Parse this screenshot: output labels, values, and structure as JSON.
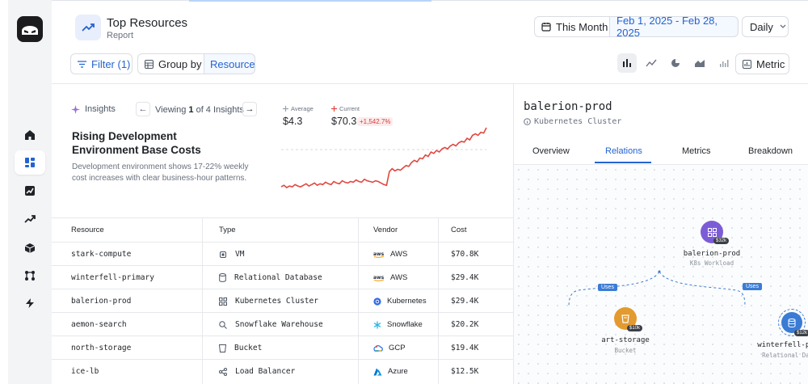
{
  "header": {
    "title": "Top Resources",
    "subtitle": "Report",
    "period_label": "This Month",
    "date_range": "Feb 1, 2025 - Feb 28, 2025",
    "granularity": "Daily",
    "filter_label": "Filter (1)",
    "group_by_label": "Group by",
    "group_by_value": "Resource",
    "metric_label": "Metric"
  },
  "insights": {
    "label": "Insights",
    "viewing_prefix": "Viewing",
    "viewing_index": "1",
    "viewing_suffix": "of 4 Insights",
    "title": "Rising Development Environment Base Costs",
    "description": "Development environment shows 17-22% weekly cost increases with clear business-hour patterns.",
    "average_label": "Average",
    "average_value": "$4.3",
    "current_label": "Current",
    "current_value": "$70.3",
    "change_badge": "+1,542.7%",
    "sparkline": [
      20,
      22,
      19,
      21,
      20,
      23,
      21,
      20,
      22,
      24,
      21,
      23,
      25,
      22,
      24,
      23,
      26,
      24,
      23,
      27,
      25,
      24,
      28,
      26,
      25,
      27,
      26,
      29,
      27,
      26,
      30,
      28,
      27,
      26,
      28,
      27,
      25,
      23,
      22,
      40,
      44,
      41,
      43,
      42,
      45,
      48,
      47,
      52,
      55,
      53,
      58,
      57,
      62,
      60,
      66,
      64,
      68,
      66,
      70,
      72,
      70,
      74,
      76,
      74,
      78,
      80,
      79,
      84,
      82,
      88,
      90,
      88,
      92,
      91,
      98
    ]
  },
  "table": {
    "headers": [
      "Resource",
      "Type",
      "Vendor",
      "Cost"
    ],
    "rows": [
      {
        "resource": "stark-compute",
        "type": "VM",
        "type_icon": "chip-icon",
        "vendor": "AWS",
        "vendor_icon": "aws-logo-icon",
        "cost": "$70.8K"
      },
      {
        "resource": "winterfell-primary",
        "type": "Relational Database",
        "type_icon": "database-icon",
        "vendor": "AWS",
        "vendor_icon": "aws-logo-icon",
        "cost": "$29.4K"
      },
      {
        "resource": "balerion-prod",
        "type": "Kubernetes Cluster",
        "type_icon": "grid-icon",
        "vendor": "Kubernetes",
        "vendor_icon": "kubernetes-logo-icon",
        "cost": "$29.4K"
      },
      {
        "resource": "aemon-search",
        "type": "Snowflake Warehouse",
        "type_icon": "search-icon",
        "vendor": "Snowflake",
        "vendor_icon": "snowflake-logo-icon",
        "cost": "$20.2K"
      },
      {
        "resource": "north-storage",
        "type": "Bucket",
        "type_icon": "bucket-icon",
        "vendor": "GCP",
        "vendor_icon": "gcp-logo-icon",
        "cost": "$19.4K"
      },
      {
        "resource": "ice-lb",
        "type": "Load Balancer",
        "type_icon": "load-balancer-icon",
        "vendor": "Azure",
        "vendor_icon": "azure-logo-icon",
        "cost": "$12.5K"
      }
    ]
  },
  "detail": {
    "title": "balerion-prod",
    "subtitle": "Kubernetes Cluster",
    "tabs": [
      "Overview",
      "Relations",
      "Metrics",
      "Breakdown"
    ],
    "active_tab": "Relations",
    "graph": {
      "root": {
        "name": "balerion-prod",
        "kind": "K8s Workload",
        "badge": "$32k",
        "color": "#7c5cd6"
      },
      "edge_label": "Uses",
      "children": [
        {
          "name": "art-storage",
          "kind": "Bucket",
          "badge": "$10k",
          "color": "#e39a2e"
        },
        {
          "name": "winterfell-primary",
          "kind": "Relational Database",
          "badge": "$12k",
          "color": "#3a7bd5"
        }
      ]
    }
  },
  "colors": {
    "accent": "#2463d0",
    "spark_line": "#e0483f",
    "badge_red": "#d63b3b"
  }
}
